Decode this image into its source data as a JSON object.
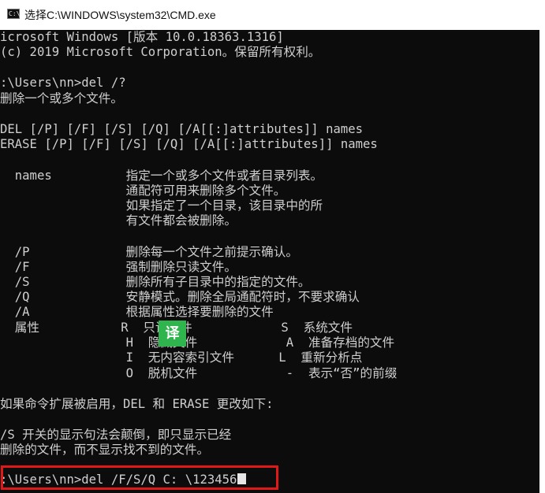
{
  "window": {
    "title": "选择C:\\WINDOWS\\system32\\CMD.exe",
    "icon_glyph": "C:\\",
    "icon": "cmd-icon"
  },
  "console": {
    "line_01": "icrosoft Windows [版本 10.0.18363.1316]",
    "line_02": "(c) 2019 Microsoft Corporation。保留所有权利。",
    "line_03": ":\\Users\\nn>del /?",
    "line_04": "删除一个或多个文件。",
    "line_05": "DEL [/P] [/F] [/S] [/Q] [/A[[:]attributes]] names",
    "line_06": "ERASE [/P] [/F] [/S] [/Q] [/A[[:]attributes]] names",
    "line_07": "  names          指定一个或多个文件或者目录列表。",
    "line_08": "                 通配符可用来删除多个文件。",
    "line_09": "                 如果指定了一个目录，该目录中的所",
    "line_10": "                 有文件都会被删除。",
    "line_11": "  /P             删除每一个文件之前提示确认。",
    "line_12": "  /F             强制删除只读文件。",
    "line_13": "  /S             删除所有子目录中的指定的文件。",
    "line_14": "  /Q             安静模式。删除全局通配符时，不要求确认",
    "line_15": "  /A             根据属性选择要删除的文件",
    "line_16": "  属性           R  只读文件            S  系统文件",
    "line_17": "                 H  隐藏文件            A  准备存档的文件",
    "line_18": "                 I  无内容索引文件      L  重新分析点",
    "line_19": "                 O  脱机文件            -  表示“否”的前缀",
    "line_20": "如果命令扩展被启用，DEL 和 ERASE 更改如下:",
    "line_21": "/S 开关的显示句法会颠倒，即只显示已经",
    "line_22": "删除的文件，而不显示找不到的文件。",
    "prompt": ":\\Users\\nn>del /F/S/Q C: \\123456"
  },
  "overlay": {
    "translate_label": "译",
    "translate_color": "#2fb44e"
  },
  "colors": {
    "console_bg": "#0c0c0c",
    "console_text": "#cfcfcf",
    "highlight_border": "#e01818"
  }
}
